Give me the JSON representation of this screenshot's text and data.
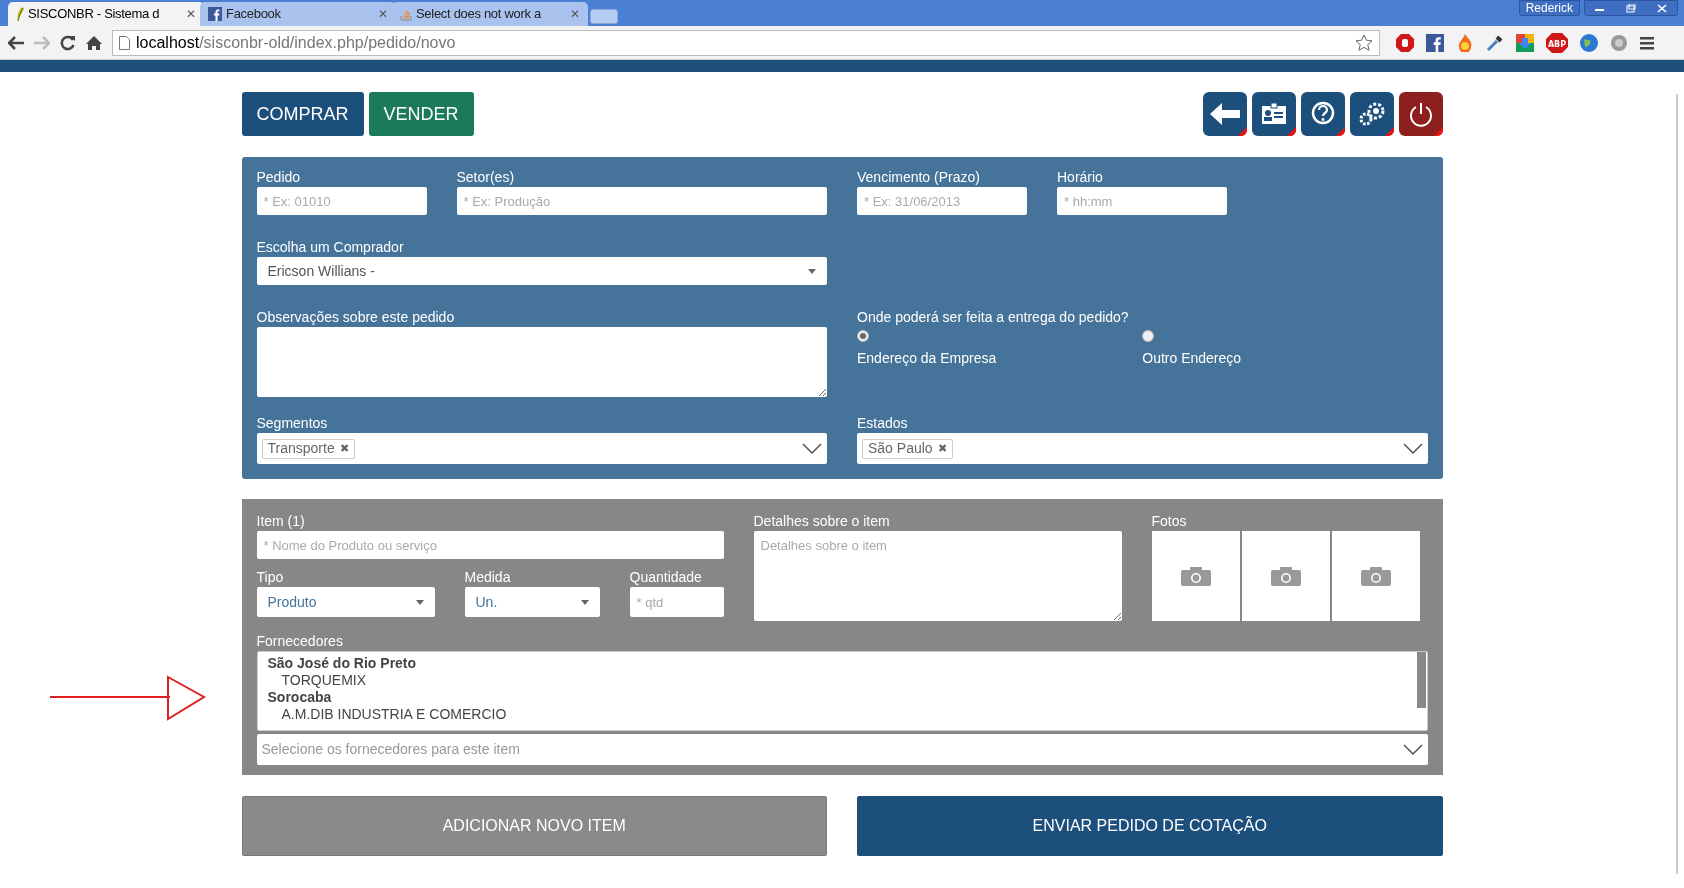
{
  "browser": {
    "tabs": [
      {
        "title": "SISCONBR - Sistema d",
        "selected": true,
        "kind": "leaf"
      },
      {
        "title": "Facebook",
        "selected": false,
        "kind": "fb"
      },
      {
        "title": "Select does not work a",
        "selected": false,
        "kind": "stack"
      }
    ],
    "close_glyph": "✕",
    "profile": "Rederick",
    "url_host": "localhost",
    "url_path": "/sisconbr-old/index.php/pedido/novo",
    "abp": "ABP"
  },
  "mode_buttons": [
    {
      "label": "COMPRAR",
      "kind": "buy"
    },
    {
      "label": "VENDER",
      "kind": "sell"
    }
  ],
  "toolbar": [
    {
      "kind": "back"
    },
    {
      "kind": "card"
    },
    {
      "kind": "help"
    },
    {
      "kind": "gears"
    },
    {
      "kind": "power"
    }
  ],
  "order": {
    "fields": [
      {
        "label": "Pedido",
        "placeholder": "* Ex: 01010"
      },
      {
        "label": "Setor(es)",
        "placeholder": "* Ex: Produção"
      },
      {
        "label": "Vencimento (Prazo)",
        "placeholder": "* Ex: 31/06/2013"
      },
      {
        "label": "Horário",
        "placeholder": "* hh:mm"
      }
    ],
    "buyer": {
      "label": "Escolha um Comprador",
      "value": "Ericson Willians -"
    },
    "notes": {
      "label": "Observações sobre este pedido"
    },
    "delivery": {
      "label": "Onde poderá ser feita a entrega do pedido?",
      "options": [
        {
          "label": "Endereço da Empresa",
          "selected": true
        },
        {
          "label": "Outro Endereço",
          "selected": false
        }
      ]
    },
    "segments": {
      "label": "Segmentos",
      "tags": [
        "Transporte"
      ]
    },
    "states": {
      "label": "Estados",
      "tags": [
        "São Paulo"
      ]
    },
    "tag_remove": "✖"
  },
  "item": {
    "name": {
      "label": "Item (1)",
      "placeholder": "* Nome do Produto ou serviço"
    },
    "type": {
      "label": "Tipo",
      "value": "Produto"
    },
    "unit": {
      "label": "Medida",
      "value": "Un."
    },
    "qty": {
      "label": "Quantidade",
      "placeholder": "* qtd"
    },
    "details": {
      "label": "Detalhes sobre o item",
      "placeholder": "Detalhes sobre o item"
    },
    "photos": {
      "label": "Fotos",
      "slots": [
        {
          "kind": "camera"
        },
        {
          "kind": "camera"
        },
        {
          "kind": "camera"
        }
      ]
    },
    "suppliers": {
      "label": "Fornecedores",
      "groups": [
        {
          "label": "São José do Rio Preto",
          "children": [
            {
              "label": "TORQUEMIX"
            }
          ]
        },
        {
          "label": "Sorocaba",
          "children": [
            {
              "label": "A.M.DIB INDUSTRIA E COMERCIO"
            }
          ]
        }
      ],
      "placeholder": "Selecione os fornecedores para este item"
    }
  },
  "actions": [
    {
      "label": "ADICIONAR NOVO ITEM",
      "kind": "secondary"
    },
    {
      "label": "ENVIAR PEDIDO DE COTAÇÃO",
      "kind": "primary"
    }
  ]
}
